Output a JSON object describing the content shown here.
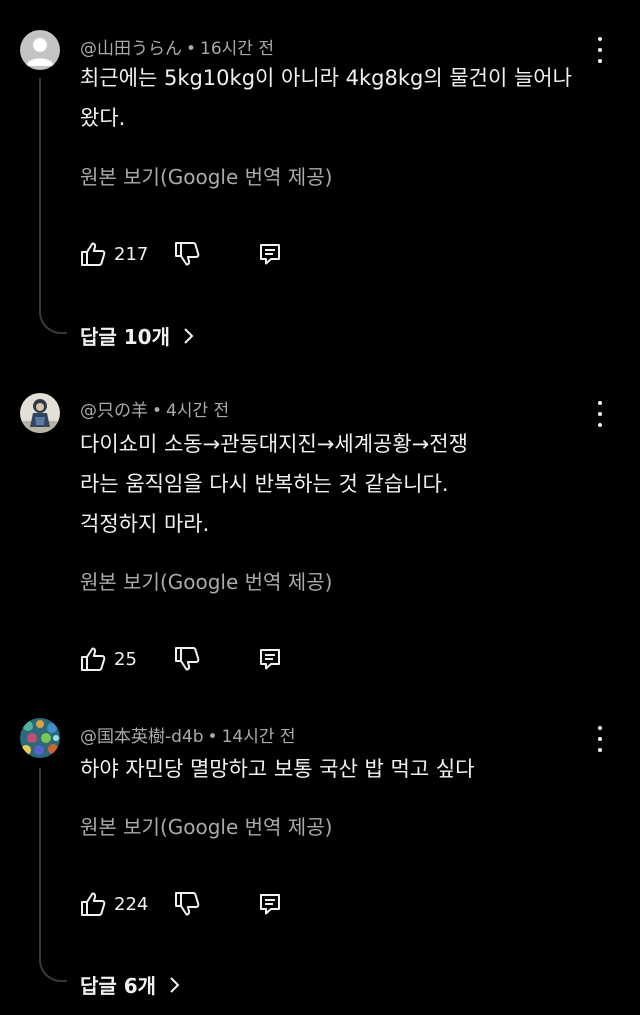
{
  "comments": [
    {
      "author": "@山田うらん",
      "time": "16시간 전",
      "lines": [
        "최근에는 5kg10kg이 아니라 4kg8kg의 물건이 늘어나",
        "왔다."
      ],
      "translate": "원본 보기(Google 번역 제공)",
      "likes": "217",
      "replies": "답글 10개",
      "avatar": "default-gray"
    },
    {
      "author": "@只の羊",
      "time": "4시간 전",
      "lines": [
        "다이쇼미 소동→관동대지진→세계공황→전쟁",
        "라는 움직임을 다시 반복하는 것 같습니다.",
        "걱정하지 마라."
      ],
      "translate": "원본 보기(Google 번역 제공)",
      "likes": "25",
      "avatar": "figure-image"
    },
    {
      "author": "@国本英樹-d4b",
      "time": "14시간 전",
      "lines": [
        "하야 자민당 멸망하고 보통 국산 밥 먹고 싶다"
      ],
      "translate": "원본 보기(Google 번역 제공)",
      "likes": "224",
      "replies": "답글 6개",
      "avatar": "colorful-pattern"
    }
  ],
  "icons": {
    "like": "thumbs-up-icon",
    "dislike": "thumbs-down-icon",
    "reply": "comment-icon",
    "menu": "more-vert-icon",
    "chevron": "chevron-right-icon"
  },
  "colors": {
    "background": "#000000",
    "text": "#f1f1f1",
    "muted": "#aaaaaa"
  }
}
